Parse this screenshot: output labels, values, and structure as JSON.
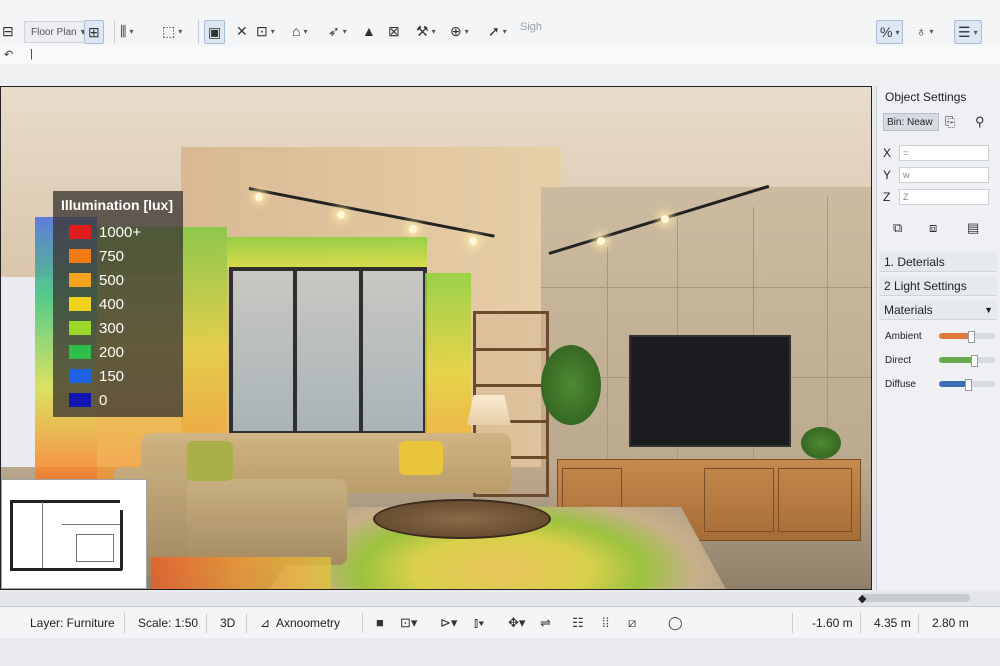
{
  "toolbar": {
    "view_dropdown": "Floor Plan",
    "sigh_label": "Sigh",
    "icons": [
      "layout-icon",
      "floorplan-icon",
      "column-icon",
      "select-icon",
      "view-icon",
      "dimension-icon",
      "stair-icon",
      "roof-icon",
      "curve-icon",
      "text-icon",
      "chart-icon",
      "tool-icon",
      "object-icon",
      "line-icon",
      "sigh-icon",
      "percent-icon",
      "mic-icon",
      "list-icon"
    ]
  },
  "toolbar2": {
    "icon": "undo-icon"
  },
  "legend": {
    "title": "Illumination [lux]",
    "entries": [
      {
        "label": "1000+",
        "color": "#e01b1b"
      },
      {
        "label": "750",
        "color": "#f07a14"
      },
      {
        "label": "500",
        "color": "#f5a21e"
      },
      {
        "label": "400",
        "color": "#f0d21a"
      },
      {
        "label": "300",
        "color": "#9cd82a"
      },
      {
        "label": "200",
        "color": "#2fbd4a"
      },
      {
        "label": "150",
        "color": "#1e62e6"
      },
      {
        "label": "0",
        "color": "#1414b4"
      }
    ]
  },
  "panel": {
    "title": "Object Settings",
    "bin_label": "Bin: Neaw",
    "fields": [
      {
        "key": "X",
        "value": "="
      },
      {
        "key": "Y",
        "value": "w"
      },
      {
        "key": "Z",
        "value": "Z"
      }
    ],
    "sections": [
      "1. Deterials",
      "2  Light Settings",
      "Materials"
    ],
    "sliders": [
      {
        "label": "Ambient",
        "color": "#e07a3a",
        "level": 0.55
      },
      {
        "label": "Direct",
        "color": "#6aa84f",
        "level": 0.6
      },
      {
        "label": "Diffuse",
        "color": "#3d6fb0",
        "level": 0.5
      }
    ]
  },
  "status": {
    "layer": "Layer: Furniture",
    "scale": "Scale: 1:50",
    "mode3d": "3D",
    "projection": "Axnoometry",
    "x": "-1.60 m",
    "y": "4.35 m",
    "z": "2.80 m"
  }
}
